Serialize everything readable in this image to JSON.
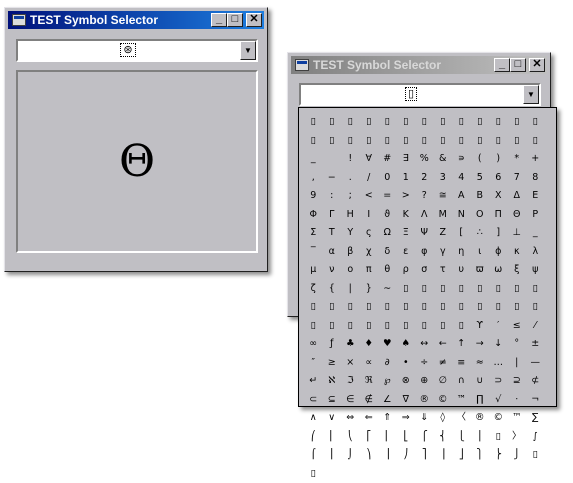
{
  "main_window": {
    "title": "TEST Symbol Selector",
    "combo_value": "⊛",
    "selected_symbol": "Θ"
  },
  "second_window": {
    "title": "TEST Symbol Selector",
    "combo_value": "▯"
  },
  "controls": {
    "minimize": "_",
    "maximize": "□",
    "close": "✕",
    "dropdown_arrow": "▼"
  },
  "symbol_grid": [
    [
      "▯",
      "▯",
      "▯",
      "▯",
      "▯",
      "▯",
      "▯",
      "▯",
      "▯",
      "▯",
      "▯",
      "▯",
      "▯"
    ],
    [
      "▯",
      "▯",
      "▯",
      "▯",
      "▯",
      "▯",
      "▯",
      "▯",
      "▯",
      "▯",
      "▯",
      "▯",
      "▯"
    ],
    [
      "_",
      "",
      "!",
      "∀",
      "#",
      "∃",
      "%",
      "&",
      "∍",
      "(",
      ")",
      "*",
      "+"
    ],
    [
      ",",
      "−",
      ".",
      "/",
      "0",
      "1",
      "2",
      "3",
      "4",
      "5",
      "6",
      "7",
      "8"
    ],
    [
      "9",
      ":",
      ";",
      "<",
      "=",
      ">",
      "?",
      "≅",
      "Α",
      "Β",
      "Χ",
      "Δ",
      "Ε"
    ],
    [
      "Φ",
      "Γ",
      "Η",
      "Ι",
      "ϑ",
      "Κ",
      "Λ",
      "Μ",
      "Ν",
      "Ο",
      "Π",
      "Θ",
      "Ρ"
    ],
    [
      "Σ",
      "Τ",
      "Υ",
      "ς",
      "Ω",
      "Ξ",
      "Ψ",
      "Ζ",
      "[",
      "∴",
      "]",
      "⊥",
      "_"
    ],
    [
      "‾",
      "α",
      "β",
      "χ",
      "δ",
      "ε",
      "φ",
      "γ",
      "η",
      "ι",
      "ϕ",
      "κ",
      "λ"
    ],
    [
      "μ",
      "ν",
      "ο",
      "π",
      "θ",
      "ρ",
      "σ",
      "τ",
      "υ",
      "ϖ",
      "ω",
      "ξ",
      "ψ"
    ],
    [
      "ζ",
      "{",
      "|",
      "}",
      "∼",
      "▯",
      "▯",
      "▯",
      "▯",
      "▯",
      "▯",
      "▯",
      "▯"
    ],
    [
      "▯",
      "▯",
      "▯",
      "▯",
      "▯",
      "▯",
      "▯",
      "▯",
      "▯",
      "▯",
      "▯",
      "▯",
      "▯"
    ],
    [
      "▯",
      "▯",
      "▯",
      "▯",
      "▯",
      "▯",
      "▯",
      "▯",
      "▯",
      "ϒ",
      "′",
      "≤",
      "⁄"
    ],
    [
      "∞",
      "ƒ",
      "♣",
      "♦",
      "♥",
      "♠",
      "↔",
      "←",
      "↑",
      "→",
      "↓",
      "°",
      "±"
    ],
    [
      "″",
      "≥",
      "×",
      "∝",
      "∂",
      "•",
      "÷",
      "≠",
      "≡",
      "≈",
      "…",
      "|",
      "—"
    ],
    [
      "↵",
      "ℵ",
      "ℑ",
      "ℜ",
      "℘",
      "⊗",
      "⊕",
      "∅",
      "∩",
      "∪",
      "⊃",
      "⊇",
      "⊄"
    ],
    [
      "⊂",
      "⊆",
      "∈",
      "∉",
      "∠",
      "∇",
      "®",
      "©",
      "™",
      "∏",
      "√",
      "⋅",
      "¬"
    ],
    [
      "∧",
      "∨",
      "⇔",
      "⇐",
      "⇑",
      "⇒",
      "⇓",
      "◊",
      "〈",
      "®",
      "©",
      "™",
      "∑"
    ],
    [
      "⎛",
      "⎜",
      "⎝",
      "⎡",
      "⎢",
      "⎣",
      "⎧",
      "⎨",
      "⎩",
      "⎪",
      "▯",
      "〉",
      "∫"
    ],
    [
      "⌠",
      "⎮",
      "⌡",
      "⎞",
      "⎟",
      "⎠",
      "⎤",
      "⎥",
      "⎦",
      "⎫",
      "⎬",
      "⎭",
      "▯"
    ],
    [
      "▯"
    ]
  ]
}
